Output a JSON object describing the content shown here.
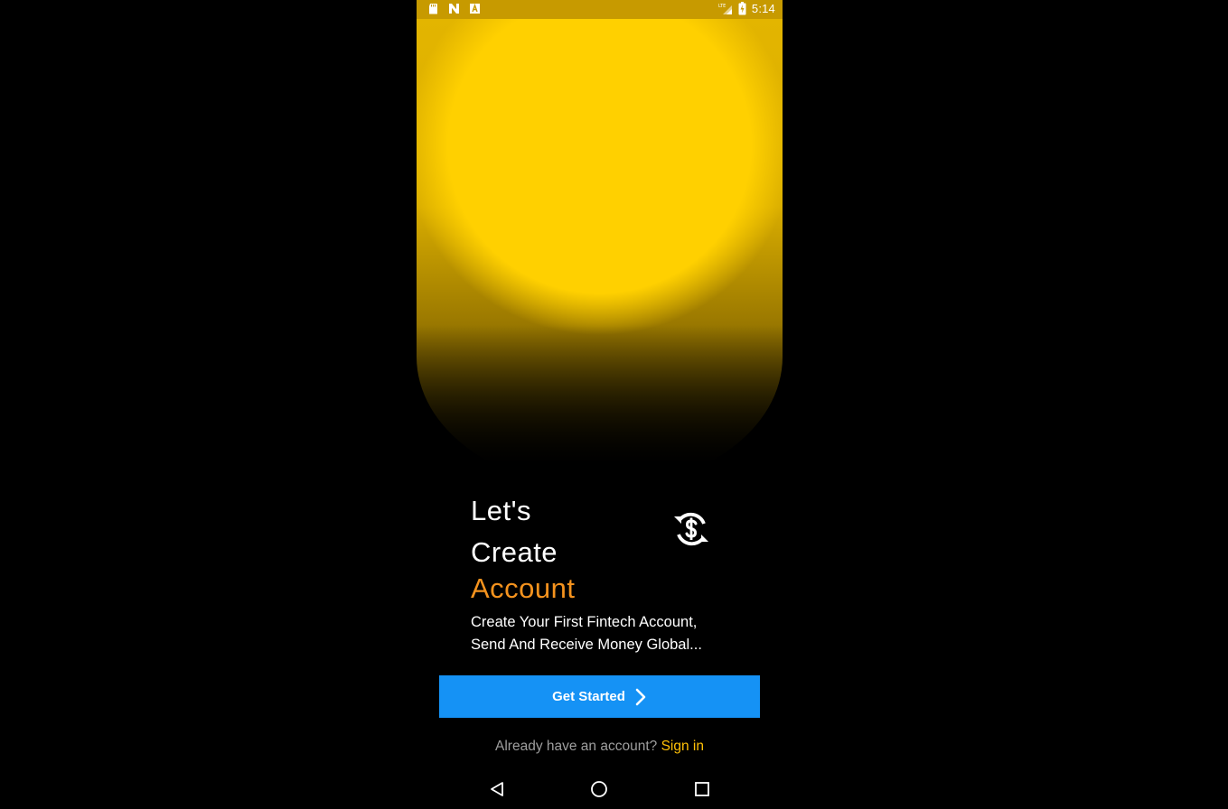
{
  "status_bar": {
    "left_icons": [
      "sd-card-icon",
      "n-notification-icon",
      "a-notification-icon"
    ],
    "right_icons": [
      "lte-signal-icon",
      "battery-charging-icon"
    ],
    "network_label": "LTE",
    "time": "5:14"
  },
  "hero": {
    "glow_color": "#ffd000",
    "title_line1": "Let's",
    "title_line2": "Create",
    "title_line3": "Account",
    "accent_color": "#f5931e",
    "icon": "currency-exchange-icon",
    "subtitle_line1": "Create Your First Fintech Account,",
    "subtitle_line2": "Send And Receive Money Global..."
  },
  "cta": {
    "label": "Get Started",
    "icon": "chevron-right-icon",
    "color": "#1592f5"
  },
  "signin": {
    "prompt": "Already have an account?",
    "link_label": "Sign in",
    "link_color": "#ffc107"
  },
  "nav_bar": {
    "buttons": [
      "back-icon",
      "home-icon",
      "recents-icon"
    ]
  }
}
